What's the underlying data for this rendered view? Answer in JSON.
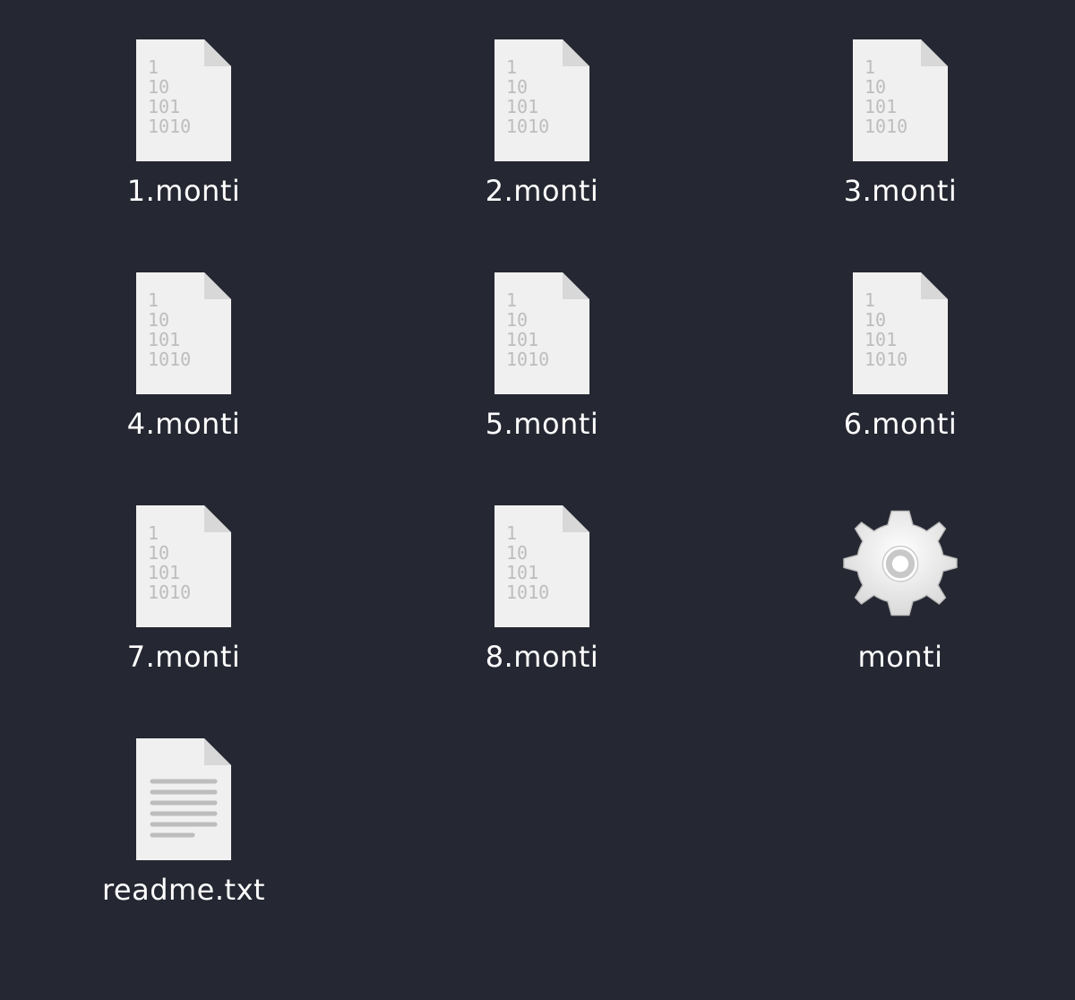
{
  "files": [
    {
      "name": "1.monti",
      "icon": "binary"
    },
    {
      "name": "2.monti",
      "icon": "binary"
    },
    {
      "name": "3.monti",
      "icon": "binary"
    },
    {
      "name": "4.monti",
      "icon": "binary"
    },
    {
      "name": "5.monti",
      "icon": "binary"
    },
    {
      "name": "6.monti",
      "icon": "binary"
    },
    {
      "name": "7.monti",
      "icon": "binary"
    },
    {
      "name": "8.monti",
      "icon": "binary"
    },
    {
      "name": "monti",
      "icon": "gear"
    },
    {
      "name": "readme.txt",
      "icon": "text"
    }
  ],
  "colors": {
    "background": "#252732",
    "paper": "#f0f0f0",
    "paper_shade": "#d8d8d8",
    "glyph": "#bdbdbd",
    "label": "#ffffff"
  }
}
